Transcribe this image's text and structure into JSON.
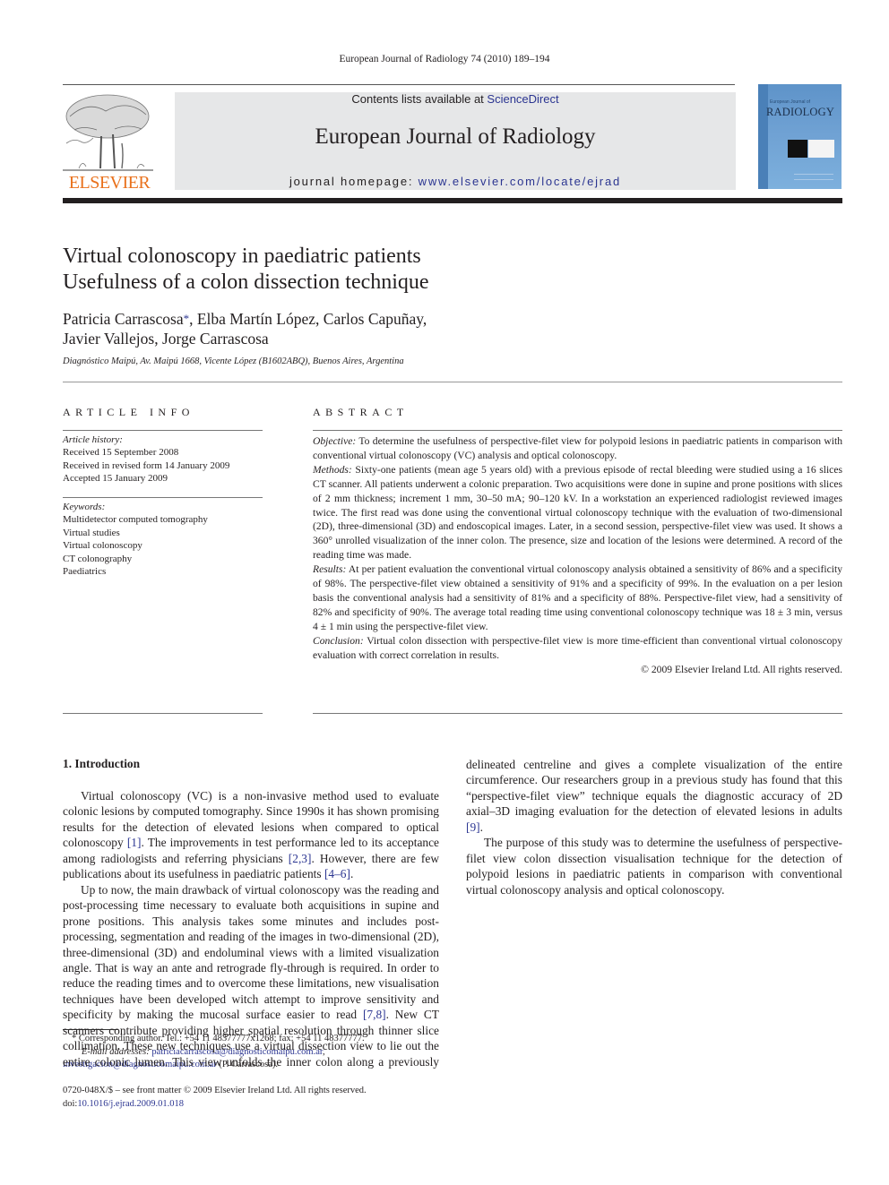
{
  "running_head": "European Journal of Radiology 74 (2010) 189–194",
  "header": {
    "publisher": "ELSEVIER",
    "contents_prefix": "Contents lists available at ",
    "contents_link": "ScienceDirect",
    "journal_title": "European Journal of Radiology",
    "homepage_prefix": "journal homepage: ",
    "homepage_url": "www.elsevier.com/locate/ejrad",
    "cover_small": "European Journal of",
    "cover_big": "RADIOLOGY"
  },
  "article": {
    "title_line1": "Virtual colonoscopy in paediatric patients",
    "title_line2": "Usefulness of a colon dissection technique",
    "authors_line1_a": "Patricia Carrascosa",
    "author_mark": "*",
    "authors_line1_b": ", Elba Martín López, Carlos Capuñay,",
    "authors_line2": "Javier Vallejos, Jorge Carrascosa",
    "affiliation": "Diagnóstico Maipú, Av. Maipú 1668, Vicente López (B1602ABQ), Buenos Aires, Argentina"
  },
  "article_info": {
    "heading": "ARTICLE INFO",
    "history_label": "Article history:",
    "history": [
      "Received 15 September 2008",
      "Received in revised form 14 January 2009",
      "Accepted 15 January 2009"
    ],
    "keywords_label": "Keywords:",
    "keywords": [
      "Multidetector computed tomography",
      "Virtual studies",
      "Virtual colonoscopy",
      "CT colonography",
      "Paediatrics"
    ]
  },
  "abstract": {
    "heading": "ABSTRACT",
    "sections": [
      {
        "label": "Objective:",
        "text": " To determine the usefulness of perspective-filet view for polypoid lesions in paediatric patients in comparison with conventional virtual colonoscopy (VC) analysis and optical colonoscopy."
      },
      {
        "label": "Methods:",
        "text": " Sixty-one patients (mean age 5 years old) with a previous episode of rectal bleeding were studied using a 16 slices CT scanner. All patients underwent a colonic preparation. Two acquisitions were done in supine and prone positions with slices of 2 mm thickness; increment 1 mm, 30–50 mA; 90–120 kV. In a workstation an experienced radiologist reviewed images twice. The first read was done using the conventional virtual colonoscopy technique with the evaluation of two-dimensional (2D), three-dimensional (3D) and endoscopical images. Later, in a second session, perspective-filet view was used. It shows a 360° unrolled visualization of the inner colon. The presence, size and location of the lesions were determined. A record of the reading time was made."
      },
      {
        "label": "Results:",
        "text": " At per patient evaluation the conventional virtual colonoscopy analysis obtained a sensitivity of 86% and a specificity of 98%. The perspective-filet view obtained a sensitivity of 91% and a specificity of 99%. In the evaluation on a per lesion basis the conventional analysis had a sensitivity of 81% and a specificity of 88%. Perspective-filet view, had a sensitivity of 82% and specificity of 90%. The average total reading time using conventional colonoscopy technique was 18 ± 3 min, versus 4 ± 1 min using the perspective-filet view."
      },
      {
        "label": "Conclusion:",
        "text": " Virtual colon dissection with perspective-filet view is more time-efficient than conventional virtual colonoscopy evaluation with correct correlation in results."
      }
    ],
    "copyright": "© 2009 Elsevier Ireland Ltd. All rights reserved."
  },
  "introduction": {
    "heading": "1.  Introduction",
    "p1_a": "Virtual colonoscopy (VC) is a non-invasive method used to evaluate colonic lesions by computed tomography. Since 1990s it has shown promising results for the detection of elevated lesions when compared to optical colonoscopy ",
    "p1_ref1": "[1]",
    "p1_b": ". The improvements in test performance led to its acceptance among radiologists and referring physicians ",
    "p1_ref2": "[2,3]",
    "p1_c": ". However, there are few publications about its usefulness in paediatric patients ",
    "p1_ref3": "[4–6]",
    "p1_d": ".",
    "p2_a": "Up to now, the main drawback of virtual colonoscopy was the reading and post-processing time necessary to evaluate both acquisitions in supine and prone positions. This analysis takes some minutes and includes post-processing, segmentation and reading of the images in two-dimensional (2D), three-dimensional (3D) and endoluminal views with a limited visualization angle. That is way an ante and retrograde fly-through is required. In order to reduce the reading times and to overcome these limitations, new visualisation techniques have been developed witch attempt to improve sensitivity and specificity by making the mucosal surface easier to read ",
    "p2_ref1": "[7,8]",
    "p2_b": ". New CT scanners contribute providing higher spatial resolution through thinner slice collimation. These new techniques use a virtual dissection view to lie out the entire colonic lumen. This view unfolds the inner colon along a previously delineated centreline and gives a complete visualization of the entire circumference. Our researchers group in a previous study has found that this “perspective-filet view” technique equals the diagnostic accuracy of 2D axial–3D imaging evaluation for the detection of elevated lesions in adults ",
    "p2_ref2": "[9]",
    "p2_c": ".",
    "p3": "The purpose of this study was to determine the usefulness of perspective-filet view colon dissection visualisation technique for the detection of polypoid lesions in paediatric patients in comparison with conventional virtual colonoscopy analysis and optical colonoscopy."
  },
  "footnote": {
    "mark": "*",
    "text": " Corresponding author. Tel.: +54 11 48377777x1268; fax: +54 11 48377777.",
    "email_label": "E-mail addresses:",
    "email1": "patriciacarrascosa@diagnosticomaipu.com.ar",
    "email2": "investigacion@diagnosticomaipu.com.ar",
    "email2_suffix": " (P. Carrascosa).",
    "front_matter": "0720-048X/$ – see front matter © 2009 Elsevier Ireland Ltd. All rights reserved.",
    "doi_label": "doi:",
    "doi": "10.1016/j.ejrad.2009.01.018"
  }
}
